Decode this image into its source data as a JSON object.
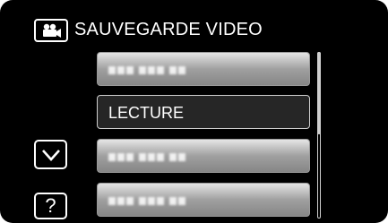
{
  "header": {
    "title": "SAUVEGARDE VIDEO",
    "icon": "movie-camera-icon"
  },
  "menu": {
    "items": [
      {
        "label": "",
        "obscured": true
      },
      {
        "label": "LECTURE",
        "highlighted": true
      },
      {
        "label": "",
        "obscured": true
      },
      {
        "label": "",
        "obscured": true
      }
    ]
  },
  "controls": {
    "scroll_down_icon": "chevron-down-icon",
    "help_label": "?"
  },
  "colors": {
    "background": "#000000",
    "item_gradient_top": "#e5e5e5",
    "item_gradient_bottom": "#868686",
    "highlight_item": "#262626",
    "foreground": "#ffffff"
  }
}
